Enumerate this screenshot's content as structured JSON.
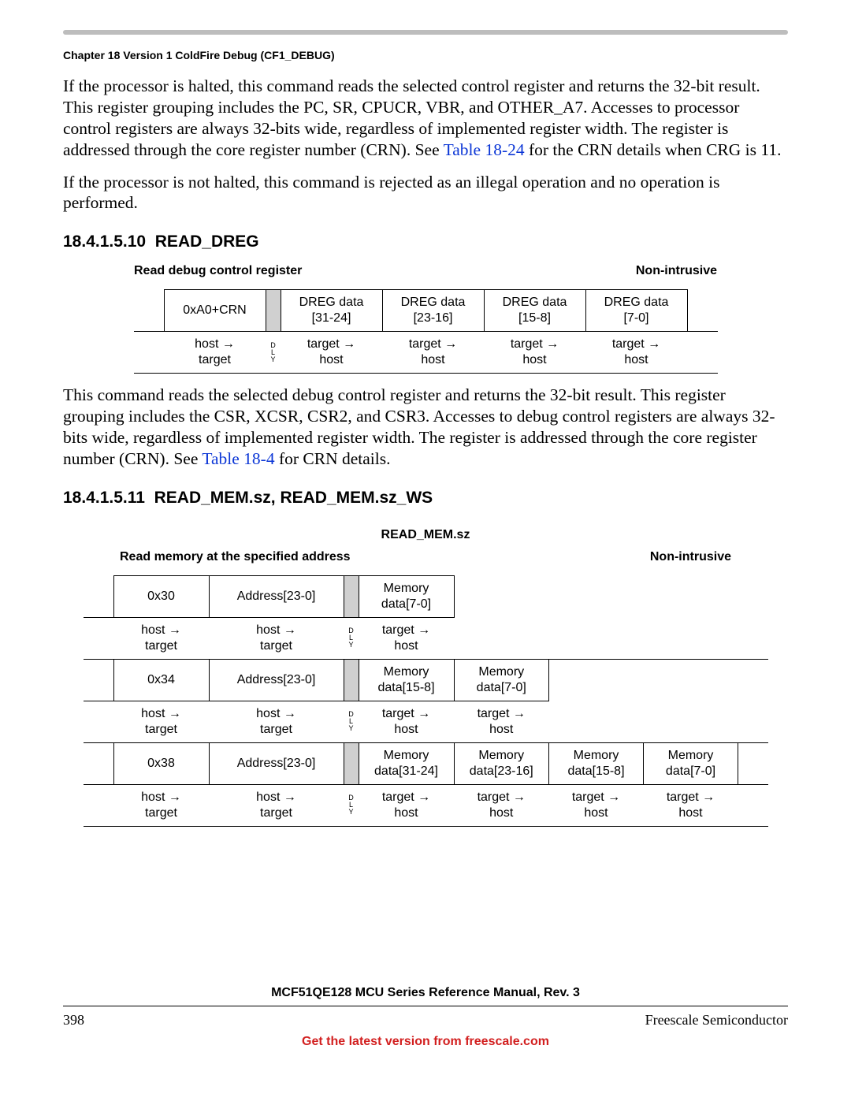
{
  "chapter_header": "Chapter 18 Version 1 ColdFire Debug (CF1_DEBUG)",
  "para1_a": "If the processor is halted, this command reads the selected control register and returns the 32-bit result. This register grouping includes the PC, SR, CPUCR, VBR, and OTHER_A7. Accesses to processor control registers are always 32-bits wide, regardless of implemented register width. The register is addressed through the core register number (CRN). See ",
  "para1_link": "Table 18-24",
  "para1_b": " for the CRN details when CRG is 11.",
  "para2": "If the processor is not halted, this command is rejected as an illegal operation and no operation is performed.",
  "sec1_num": "18.4.1.5.10",
  "sec1_title": "READ_DREG",
  "cmd1_left": "Read debug control register",
  "cmd1_right": "Non-intrusive",
  "dly_label": "D\nL\nY",
  "host_target": "host →\ntarget",
  "target_host": "target →\nhost",
  "t1": {
    "c0": "0xA0+CRN",
    "c1": "DREG data\n[31-24]",
    "c2": "DREG data\n[23-16]",
    "c3": "DREG data\n[15-8]",
    "c4": "DREG data\n[7-0]"
  },
  "para3_a": "This command reads the selected debug control register and returns the 32-bit result. This register grouping includes the CSR, XCSR, CSR2, and CSR3. Accesses to debug control registers are always 32-bits wide, regardless of implemented register width. The register is addressed through the core register number (CRN). See ",
  "para3_link": "Table 18-4",
  "para3_b": " for CRN details.",
  "sec2_num": "18.4.1.5.11",
  "sec2_title": "READ_MEM.sz, READ_MEM.sz_WS",
  "cmd2_title": "READ_MEM.sz",
  "cmd2_left": "Read memory at the specified address",
  "cmd2_right": "Non-intrusive",
  "addr": "Address[23-0]",
  "r1": {
    "op": "0x30",
    "d0": "Memory\ndata[7-0]"
  },
  "r2": {
    "op": "0x34",
    "d0": "Memory\ndata[15-8]",
    "d1": "Memory\ndata[7-0]"
  },
  "r3": {
    "op": "0x38",
    "d0": "Memory\ndata[31-24]",
    "d1": "Memory\ndata[23-16]",
    "d2": "Memory\ndata[15-8]",
    "d3": "Memory\ndata[7-0]"
  },
  "footer_title": "MCF51QE128 MCU Series Reference Manual, Rev. 3",
  "page_num": "398",
  "vendor": "Freescale Semiconductor",
  "footer_link": "Get the latest version from freescale.com"
}
